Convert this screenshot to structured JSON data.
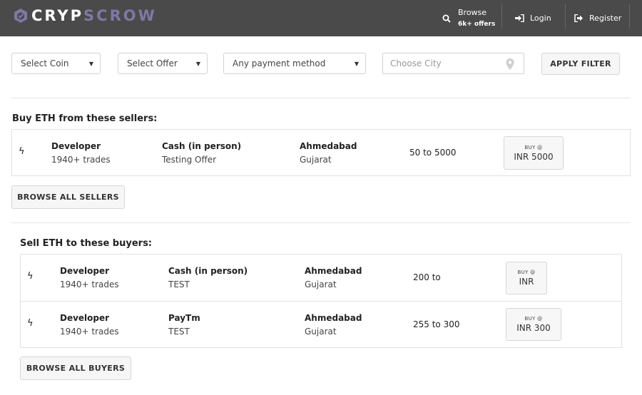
{
  "brand": {
    "part1": "CRYP",
    "part2": "SCROW"
  },
  "nav": {
    "browse_label": "Browse",
    "browse_sub": "6k+ offers",
    "login_label": "Login",
    "register_label": "Register"
  },
  "filters": {
    "coin": "Select Coin",
    "offer": "Select Offer",
    "payment": "Any payment method",
    "city_placeholder": "Choose City",
    "apply_label": "APPLY FILTER"
  },
  "sellers": {
    "title": "Buy ETH from these sellers:",
    "browse_label": "BROWSE ALL SELLERS",
    "rows": [
      {
        "name": "Developer",
        "trades": "1940+ trades",
        "method": "Cash (in person)",
        "note": "Testing Offer",
        "city": "Ahmedabad",
        "state": "Gujarat",
        "range": "50 to 5000",
        "btn_top": "BUY @",
        "btn_price": "INR 5000"
      }
    ]
  },
  "buyers": {
    "title": "Sell ETH to these buyers:",
    "browse_label": "BROWSE ALL BUYERS",
    "rows": [
      {
        "name": "Developer",
        "trades": "1940+ trades",
        "method": "Cash (in person)",
        "note": "TEST",
        "city": "Ahmedabad",
        "state": "Gujarat",
        "range": "200 to",
        "btn_top": "BUY @",
        "btn_price": "INR"
      },
      {
        "name": "Developer",
        "trades": "1940+ trades",
        "method": "PayTm",
        "note": "TEST",
        "city": "Ahmedabad",
        "state": "Gujarat",
        "range": "255 to 300",
        "btn_top": "BUY @",
        "btn_price": "INR 300"
      }
    ]
  },
  "colors": {
    "topbar": "#4a4a4a",
    "brand_accent": "#7e78a6"
  },
  "icons": {
    "logo": "logo-mark-icon",
    "search": "search-icon",
    "login": "login-icon",
    "register": "register-icon",
    "pin": "location-pin-icon",
    "bolt": "lightning-icon"
  }
}
